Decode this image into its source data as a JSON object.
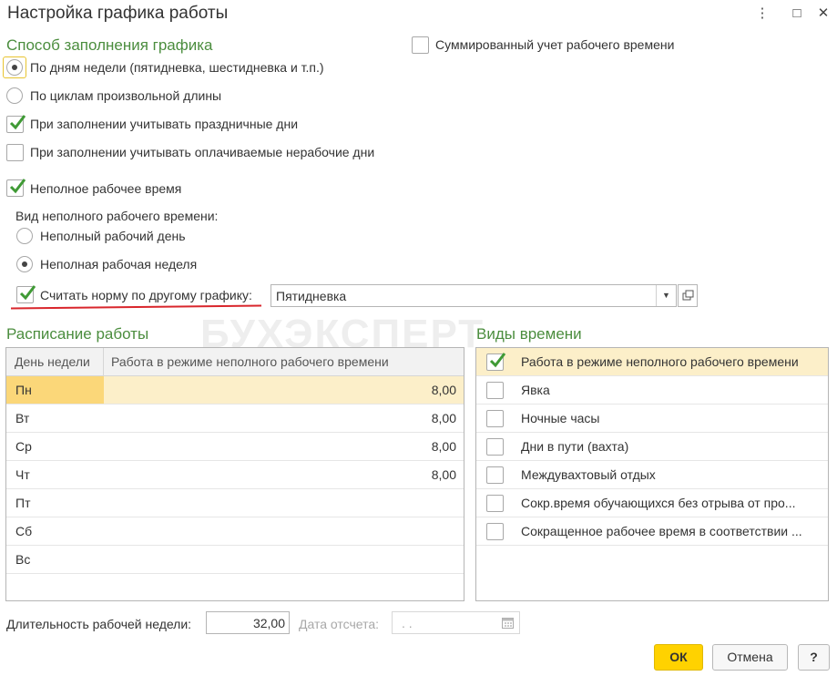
{
  "window": {
    "title": "Настройка графика работы",
    "controls": [
      "⋮",
      "□",
      "✕"
    ]
  },
  "fill_method": {
    "header": "Способ заполнения графика",
    "options": [
      {
        "label": "По дням недели (пятидневка, шестидневка и т.п.)",
        "selected": true
      },
      {
        "label": "По циклам произвольной длины",
        "selected": false
      }
    ],
    "checks": [
      {
        "label": "При заполнении учитывать праздничные дни",
        "checked": true
      },
      {
        "label": "При заполнении учитывать оплачиваемые нерабочие дни",
        "checked": false
      }
    ]
  },
  "summary_check": {
    "label": "Суммированный учет рабочего времени",
    "checked": false
  },
  "part_time": {
    "check_label": "Неполное рабочее время",
    "checked": true,
    "kind_label": "Вид неполного рабочего времени:",
    "options": [
      {
        "label": "Неполный рабочий день",
        "selected": false
      },
      {
        "label": "Неполная рабочая неделя",
        "selected": true
      }
    ],
    "norm_label": "Считать норму по другому графику:",
    "norm_checked": true,
    "norm_value": "Пятидневка"
  },
  "watermark": "БУХЭКСПЕРТ",
  "schedule": {
    "header": "Расписание работы",
    "columns": [
      "День недели",
      "Работа в режиме неполного рабочего времени"
    ],
    "rows": [
      {
        "day": "Пн",
        "value": "8,00"
      },
      {
        "day": "Вт",
        "value": "8,00"
      },
      {
        "day": "Ср",
        "value": "8,00"
      },
      {
        "day": "Чт",
        "value": "8,00"
      },
      {
        "day": "Пт",
        "value": ""
      },
      {
        "day": "Сб",
        "value": ""
      },
      {
        "day": "Вс",
        "value": ""
      }
    ]
  },
  "time_types": {
    "header": "Виды времени",
    "items": [
      {
        "label": "Работа в режиме неполного рабочего времени",
        "checked": true
      },
      {
        "label": "Явка",
        "checked": false
      },
      {
        "label": "Ночные часы",
        "checked": false
      },
      {
        "label": "Дни в пути (вахта)",
        "checked": false
      },
      {
        "label": "Междувахтовый отдых",
        "checked": false
      },
      {
        "label": "Сокр.время обучающихся без отрыва от про...",
        "checked": false
      },
      {
        "label": "Сокращенное рабочее время в соответствии ...",
        "checked": false
      }
    ]
  },
  "footer": {
    "week_length_label": "Длительность рабочей недели:",
    "week_length_value": "32,00",
    "date_label": "Дата отсчета:",
    "date_value": ". .",
    "ok_label": "ОК",
    "cancel_label": "Отмена",
    "help_label": "?"
  },
  "colors": {
    "accent_green": "#4b8d3e",
    "check_green": "#3f9a35",
    "selected_row": "#fcefc9",
    "ok_button": "#ffd200",
    "underline_red": "#d9262c"
  }
}
